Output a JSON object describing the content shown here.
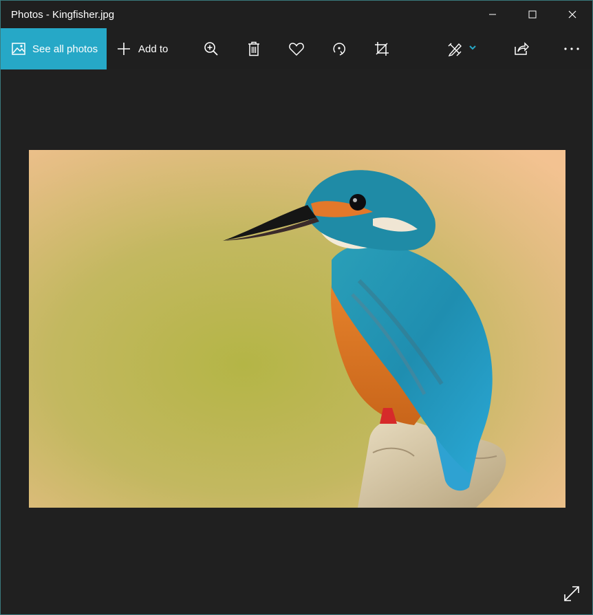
{
  "window": {
    "title": "Photos - Kingfisher.jpg"
  },
  "toolbar": {
    "see_all_label": "See all photos",
    "add_to_label": "Add to",
    "accent_color": "#26a8c7"
  },
  "icons": {
    "see_all": "image-icon",
    "add_to": "plus-icon",
    "zoom": "zoom-in-icon",
    "delete": "trash-icon",
    "favorite": "heart-icon",
    "rotate": "rotate-icon",
    "crop": "crop-icon",
    "edit": "edit-create-icon",
    "share": "share-icon",
    "more": "more-icon",
    "fullscreen": "fullscreen-icon"
  },
  "photo": {
    "subject": "kingfisher"
  }
}
